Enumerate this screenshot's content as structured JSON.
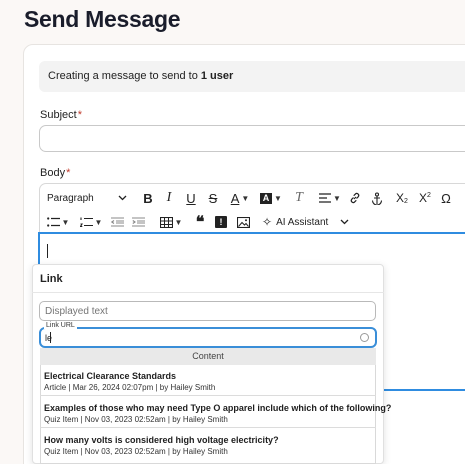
{
  "page": {
    "title": "Send Message"
  },
  "info": {
    "prefix": "Creating a message to send to ",
    "count": "1 user"
  },
  "subject": {
    "label": "Subject",
    "required_mark": "*",
    "value": ""
  },
  "body": {
    "label": "Body",
    "required_mark": "*"
  },
  "toolbar": {
    "paragraph_select": "Paragraph",
    "ai_assistant": "AI Assistant",
    "clear_format_glyph": "T",
    "subscript_glyph": "X",
    "superscript_glyph": "X",
    "omega_glyph": "Ω"
  },
  "link_dialog": {
    "title": "Link",
    "displayed_text_placeholder": "Displayed text",
    "url_label": "Link URL",
    "url_value": "le",
    "results_header": "Content",
    "results": [
      {
        "title": "Electrical Clearance Standards",
        "meta": "Article | Mar 26, 2024 02:07pm | by Hailey Smith"
      },
      {
        "title": "Examples of those who may need Type O apparel include which of the following?",
        "meta": "Quiz Item | Nov 03, 2023 02:52am | by Hailey Smith"
      },
      {
        "title": "How many volts is considered high voltage electricity?",
        "meta": "Quiz Item | Nov 03, 2023 02:52am | by Hailey Smith"
      }
    ]
  },
  "colors": {
    "accent": "#2f8ce0",
    "required": "#c0392b"
  }
}
